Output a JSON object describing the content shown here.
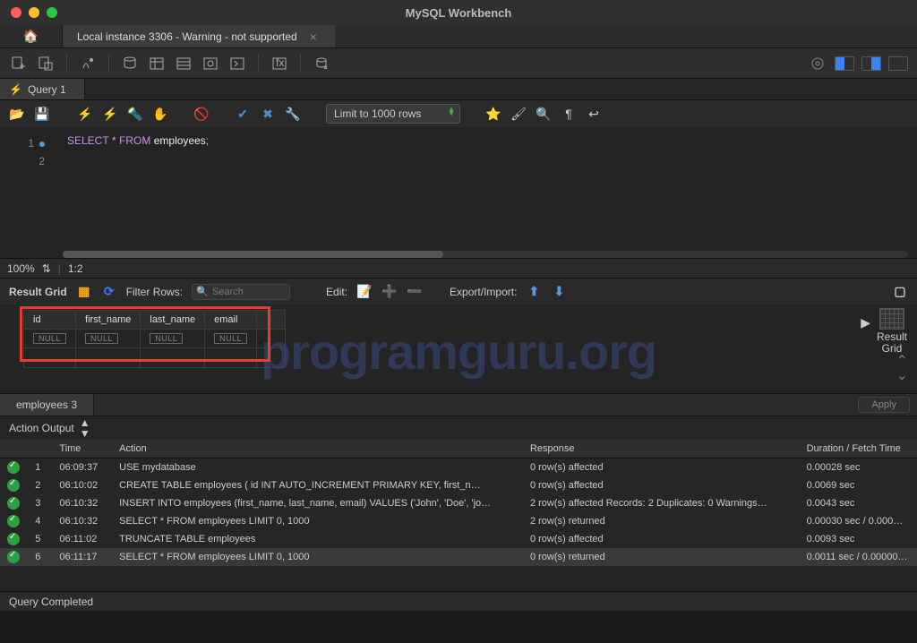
{
  "window": {
    "title": "MySQL Workbench"
  },
  "connection_tab": {
    "label": "Local instance 3306 - Warning - not supported"
  },
  "query_tab": {
    "label": "Query 1"
  },
  "limit_rows": {
    "label": "Limit to 1000 rows"
  },
  "editor": {
    "zoom": "100%",
    "cursor": "1:2",
    "line1": "1",
    "line2": "2",
    "kw_select": "SELECT",
    "star": "*",
    "kw_from": "FROM",
    "ident": "employees",
    "semi": ";"
  },
  "result_tools": {
    "title": "Result Grid",
    "filter_label": "Filter Rows:",
    "search_placeholder": "Search",
    "edit_label": "Edit:",
    "export_label": "Export/Import:"
  },
  "result_columns": [
    "id",
    "first_name",
    "last_name",
    "email"
  ],
  "result_row": [
    "NULL",
    "NULL",
    "NULL",
    "NULL"
  ],
  "side_panel": {
    "label": "Result Grid"
  },
  "result_tab": {
    "label": "employees 3"
  },
  "apply": {
    "label": "Apply"
  },
  "action_output": {
    "label": "Action Output"
  },
  "ao_headers": {
    "time": "Time",
    "action": "Action",
    "response": "Response",
    "duration": "Duration / Fetch Time"
  },
  "ao_rows": [
    {
      "n": "1",
      "t": "06:09:37",
      "a": "USE mydatabase",
      "r": "0 row(s) affected",
      "d": "0.00028 sec"
    },
    {
      "n": "2",
      "t": "06:10:02",
      "a": "CREATE TABLE employees (     id INT AUTO_INCREMENT PRIMARY KEY,     first_n…",
      "r": "0 row(s) affected",
      "d": "0.0069 sec"
    },
    {
      "n": "3",
      "t": "06:10:32",
      "a": "INSERT INTO employees (first_name, last_name, email) VALUES ('John', 'Doe', 'jo…",
      "r": "2 row(s) affected Records: 2  Duplicates: 0  Warnings…",
      "d": "0.0043 sec"
    },
    {
      "n": "4",
      "t": "06:10:32",
      "a": "SELECT * FROM employees LIMIT 0, 1000",
      "r": "2 row(s) returned",
      "d": "0.00030 sec / 0.000…"
    },
    {
      "n": "5",
      "t": "06:11:02",
      "a": "TRUNCATE TABLE employees",
      "r": "0 row(s) affected",
      "d": "0.0093 sec"
    },
    {
      "n": "6",
      "t": "06:11:17",
      "a": "SELECT * FROM employees LIMIT 0, 1000",
      "r": "0 row(s) returned",
      "d": "0.0011 sec / 0.00000…"
    }
  ],
  "footer": {
    "status": "Query Completed"
  },
  "watermark": "programguru.org"
}
